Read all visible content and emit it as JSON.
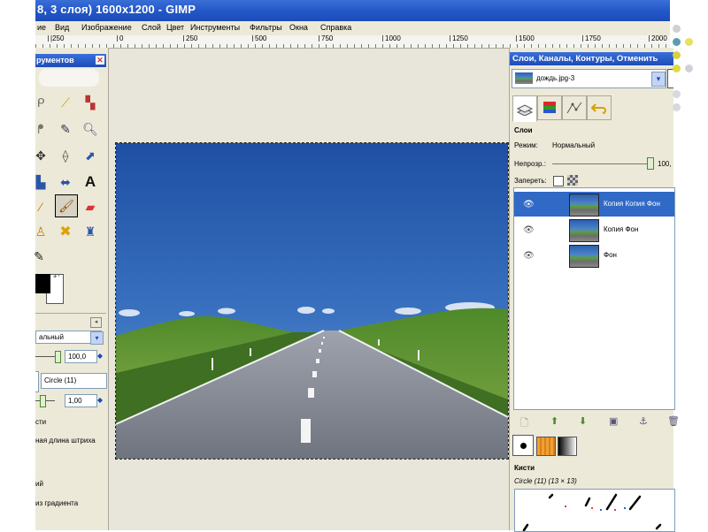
{
  "window": {
    "title": "8, 3 слоя) 1600x1200 - GIMP"
  },
  "menu": {
    "items": [
      "ие",
      "Вид",
      "Изображение",
      "Слой",
      "Цвет",
      "Инструменты",
      "Фильтры",
      "Окна",
      "Справка"
    ]
  },
  "ruler": {
    "labels": [
      "|250",
      "0",
      "250",
      "500",
      "750",
      "1000",
      "1250",
      "1500",
      "1750",
      "2000"
    ]
  },
  "toolbox": {
    "title": "рументов",
    "icons": [
      "lasso-icon",
      "magic-wand-icon",
      "color-select-icon",
      "paths-icon",
      "color-picker-icon",
      "zoom-icon",
      "measure-icon",
      "move-icon",
      "align-icon",
      "crop-icon",
      "rotate-icon",
      "scale-icon",
      "flip-icon",
      "text-icon",
      "pencil-icon",
      "paintbrush-icon",
      "eraser-icon",
      "clone-icon",
      "heal-icon",
      "smudge-icon",
      "dodge-icon"
    ],
    "mode_value": "альный",
    "opacity_value": "100,0",
    "brush_value": "Circle (11)",
    "scale_value": "1,00",
    "label_brush_dynamics": "сти",
    "label_stroke_length": "ная длина штриха",
    "label_fade": "ий",
    "label_gradient": "из градиента"
  },
  "dock": {
    "title": "Слои, Каналы, Контуры, Отменить",
    "image_name": "дождь.jpg-3",
    "section_title": "Слои",
    "mode_label": "Режим:",
    "mode_value": "Нормальный",
    "opacity_label": "Непрозр.:",
    "opacity_value": "100,",
    "lock_label": "Запереть:",
    "layers": [
      {
        "name": "Копия Копия Фон",
        "selected": true
      },
      {
        "name": "Копия Фон",
        "selected": false
      },
      {
        "name": "Фон",
        "selected": false
      }
    ],
    "brushes_title": "Кисти",
    "brush_name": "Circle (11) (13 × 13)"
  },
  "colors": {
    "accent": "#1c4cb8",
    "selection": "#3169c6",
    "panel_bg": "#ece9d8"
  }
}
